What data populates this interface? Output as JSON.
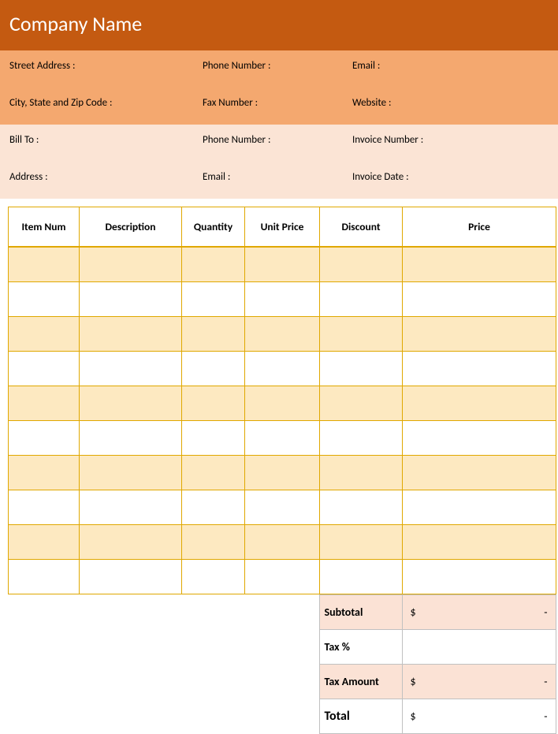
{
  "header": {
    "company_name": "Company Name"
  },
  "info": {
    "row1": {
      "c1a": "Street Address :",
      "c2a": "Phone Number :",
      "c3a": "Email :",
      "c1b": "City, State and Zip Code :",
      "c2b": "Fax Number :",
      "c3b": "Website :"
    },
    "row2": {
      "c1a": "Bill To :",
      "c2a": "Phone Number :",
      "c3a": "Invoice Number :",
      "c1b": "Address :",
      "c2b": "Email :",
      "c3b": "Invoice Date :"
    }
  },
  "table": {
    "headers": [
      "Item Num",
      "Description",
      "Quantity",
      "Unit Price",
      "Discount",
      "Price"
    ],
    "rows": [
      "",
      "",
      "",
      "",
      "",
      "",
      "",
      "",
      "",
      ""
    ]
  },
  "totals": {
    "subtotal_label": "Subtotal",
    "subtotal_cur": "$",
    "subtotal_val": "-",
    "taxpct_label": "Tax %",
    "taxpct_val": "",
    "taxamt_label": "Tax Amount",
    "taxamt_cur": "$",
    "taxamt_val": "-",
    "total_label": "Total",
    "total_cur": "$",
    "total_val": "-"
  }
}
